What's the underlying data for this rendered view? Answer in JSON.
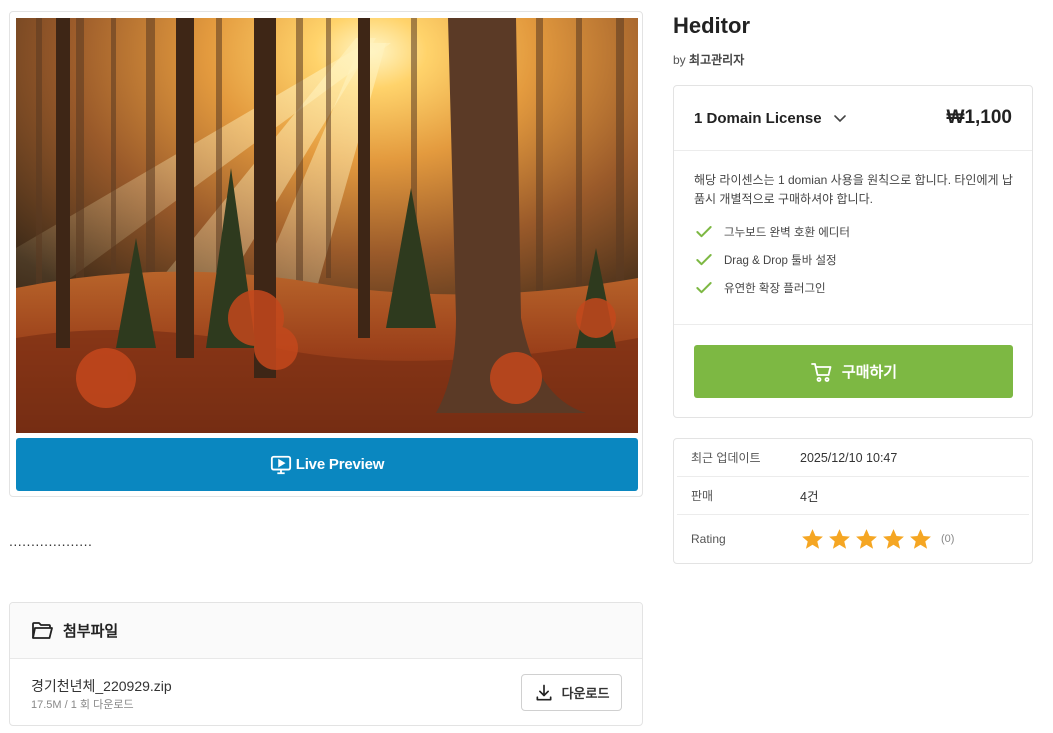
{
  "preview": {
    "image_alt": "autumn forest with sun rays",
    "live_preview_label": "Live Preview"
  },
  "description_text": "...................",
  "attachments": {
    "title": "첨부파일",
    "file": {
      "name": "경기천년체_220929.zip",
      "meta": "17.5M / 1 회 다운로드"
    },
    "download_label": "다운로드"
  },
  "product": {
    "title": "Heditor",
    "author_prefix": "by",
    "author": "최고관리자"
  },
  "license": {
    "name": "1 Domain License",
    "price": "₩1,100",
    "description": "해당 라이센스는 1 domian 사용을 원칙으로 합니다. 타인에게 납품시 개별적으로 구매하셔야 합니다.",
    "features": [
      "그누보드 완벽 호환 에디터",
      "Drag & Drop 툴바 설정",
      "유연한 확장 플러그인"
    ],
    "buy_label": "구매하기"
  },
  "info": {
    "updated_label": "최근 업데이트",
    "updated_value": "2025/12/10 10:47",
    "sales_label": "판매",
    "sales_value": "4건",
    "rating_label": "Rating",
    "rating_stars": 5,
    "rating_count": "(0)"
  },
  "colors": {
    "live_preview_bg": "#0a87c0",
    "buy_bg": "#7db843",
    "check": "#7db843",
    "star": "#f5a623"
  },
  "icons": {
    "live_preview": "monitor-play-icon",
    "folder": "folder-open-icon",
    "download": "download-icon",
    "chevron": "chevron-down-icon",
    "check": "check-icon",
    "cart": "cart-icon",
    "star": "star-icon"
  }
}
